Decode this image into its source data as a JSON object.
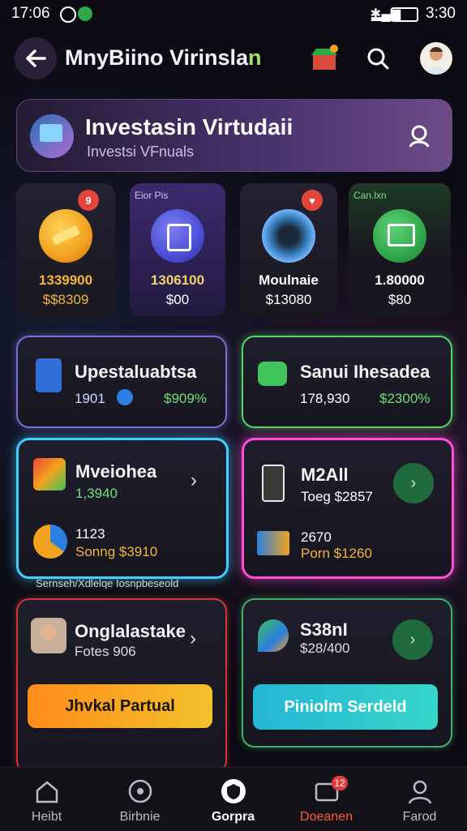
{
  "status_bar": {
    "time": "17:06",
    "clock": "3:30"
  },
  "header": {
    "title_main": "MnyBiino Virinsla",
    "title_tail": "n"
  },
  "hero": {
    "title": "Investasin Virtudaii",
    "subtitle": "Investsi VFnuals"
  },
  "tiles": [
    {
      "tag": "",
      "badge": "9",
      "value": "1339900",
      "sub": "$$8309",
      "color": "#f2a21d"
    },
    {
      "tag": "Eior Pis",
      "badge": "",
      "value": "1306100",
      "sub": "$00",
      "color": "#4b4fd6"
    },
    {
      "tag": "",
      "badge": "♥",
      "value": "Moulnaie",
      "sub": "$13080",
      "color": "#2f6fa8"
    },
    {
      "tag": "Can.lxn",
      "badge": "",
      "value": "1.80000",
      "sub": "$80",
      "color": "#2fa84a"
    }
  ],
  "row1": [
    {
      "title": "Upestaluabtsa",
      "num": "1901",
      "pct": "$909%"
    },
    {
      "title": "Sanui Ihesadea",
      "num": "178,930",
      "pct": "$2300%"
    }
  ],
  "row2": [
    {
      "title": "Mveiohea",
      "value": "1,3940",
      "b_num": "1123",
      "b_text": "Sonng $3910"
    },
    {
      "title": "M2All",
      "value": "Toeg $2857",
      "b_num": "2670",
      "b_text": "Porn $1260"
    }
  ],
  "caption": "Sernseh/Xdlelqe Iosnpbeseold",
  "row3": [
    {
      "title": "Onglalastake",
      "sub": "Fotes 906",
      "button": "Jhvkal Partual"
    },
    {
      "title": "S38nI",
      "sub": "$28/400",
      "button": "Piniolm Serdeld"
    }
  ],
  "nav": [
    {
      "label": "Heibt",
      "active": false
    },
    {
      "label": "Birbnie",
      "active": false
    },
    {
      "label": "Gorpra",
      "active": true
    },
    {
      "label": "Doeanen",
      "active": false,
      "badge": "12"
    },
    {
      "label": "Farod",
      "active": false
    }
  ],
  "colors": {
    "accent_green": "#6fe07a",
    "accent_blue": "#3fd0ff",
    "accent_pink": "#ff4fd8",
    "accent_red": "#ff3b3b"
  }
}
